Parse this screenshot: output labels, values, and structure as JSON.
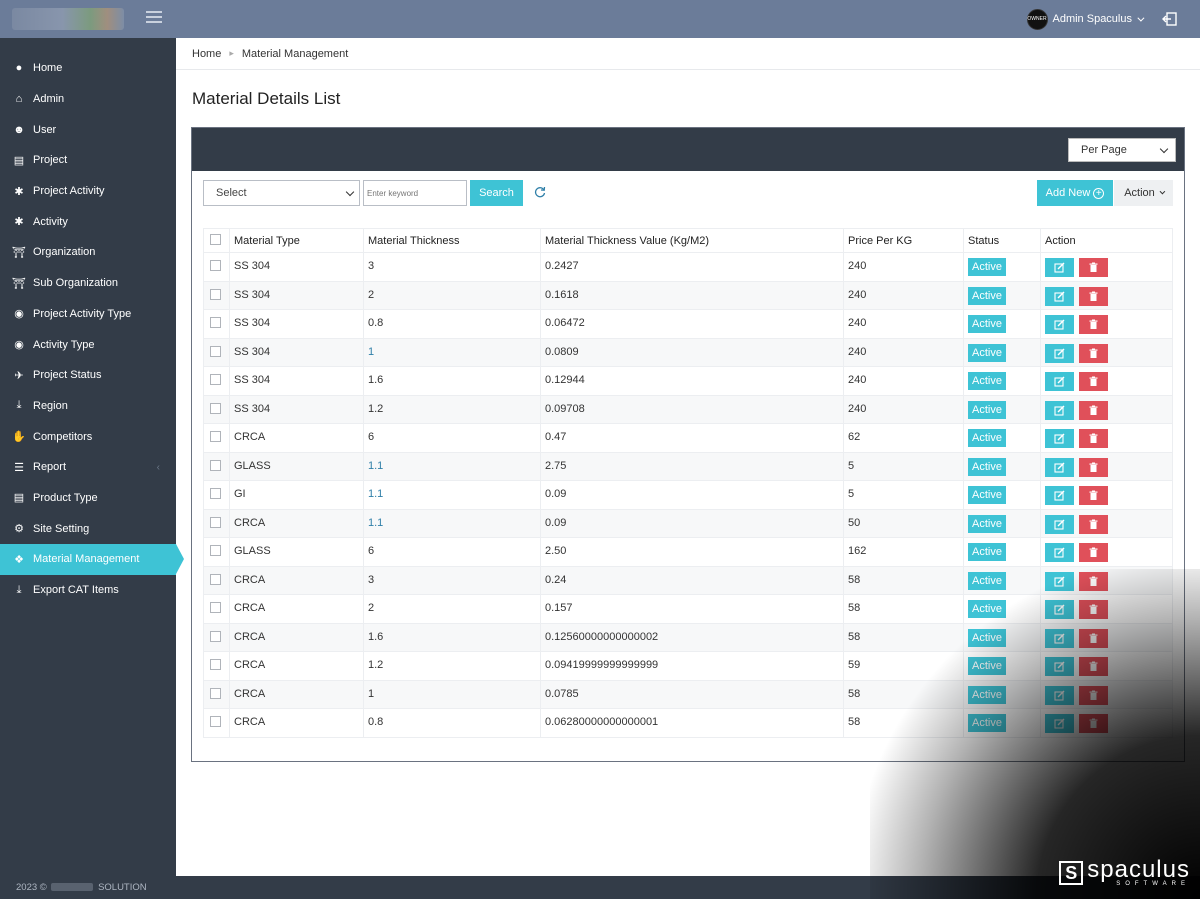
{
  "header": {
    "user_name": "Admin Spaculus",
    "avatar_text": "OWNER"
  },
  "sidebar": {
    "items": [
      {
        "label": "Home",
        "icon": "users-icon"
      },
      {
        "label": "Admin",
        "icon": "home-icon"
      },
      {
        "label": "User",
        "icon": "user-icon"
      },
      {
        "label": "Project",
        "icon": "laptop-icon"
      },
      {
        "label": "Project Activity",
        "icon": "asterisk-icon"
      },
      {
        "label": "Activity",
        "icon": "asterisk-icon"
      },
      {
        "label": "Organization",
        "icon": "bank-icon"
      },
      {
        "label": "Sub Organization",
        "icon": "bank-icon"
      },
      {
        "label": "Project Activity Type",
        "icon": "dot-circle-icon"
      },
      {
        "label": "Activity Type",
        "icon": "dot-circle-icon"
      },
      {
        "label": "Project Status",
        "icon": "plane-icon"
      },
      {
        "label": "Region",
        "icon": "download-icon"
      },
      {
        "label": "Competitors",
        "icon": "hand-icon"
      },
      {
        "label": "Report",
        "icon": "list-icon"
      },
      {
        "label": "Product Type",
        "icon": "list-alt-icon"
      },
      {
        "label": "Site Setting",
        "icon": "gear-icon"
      },
      {
        "label": "Material Management",
        "icon": "cubes-icon"
      },
      {
        "label": "Export CAT Items",
        "icon": "download-icon"
      }
    ],
    "active": "Material Management"
  },
  "footer": {
    "year": "2023 ©",
    "company": "SOLUTION"
  },
  "breadcrumb": {
    "home": "Home",
    "current": "Material Management"
  },
  "page": {
    "title": "Material Details List"
  },
  "controls": {
    "per_page": "Per Page",
    "select": "Select",
    "keyword_placeholder": "Enter keyword",
    "search": "Search",
    "add_new": "Add New",
    "action": "Action"
  },
  "table": {
    "columns": [
      "Material Type",
      "Material Thickness",
      "Material Thickness Value (Kg/M2)",
      "Price Per KG",
      "Status",
      "Action"
    ],
    "rows": [
      {
        "type": "SS 304",
        "thickness": "3",
        "value": "0.2427",
        "price": "240",
        "status": "Active"
      },
      {
        "type": "SS 304",
        "thickness": "2",
        "value": "0.1618",
        "price": "240",
        "status": "Active"
      },
      {
        "type": "SS 304",
        "thickness": "0.8",
        "value": "0.06472",
        "price": "240",
        "status": "Active"
      },
      {
        "type": "SS 304",
        "thickness": "1",
        "value": "0.0809",
        "price": "240",
        "status": "Active"
      },
      {
        "type": "SS 304",
        "thickness": "1.6",
        "value": "0.12944",
        "price": "240",
        "status": "Active"
      },
      {
        "type": "SS 304",
        "thickness": "1.2",
        "value": "0.09708",
        "price": "240",
        "status": "Active"
      },
      {
        "type": "CRCA",
        "thickness": "6",
        "value": "0.47",
        "price": "62",
        "status": "Active"
      },
      {
        "type": "GLASS",
        "thickness": "1.1",
        "value": "2.75",
        "price": "5",
        "status": "Active"
      },
      {
        "type": "GI",
        "thickness": "1.1",
        "value": "0.09",
        "price": "5",
        "status": "Active"
      },
      {
        "type": "CRCA",
        "thickness": "1.1",
        "value": "0.09",
        "price": "50",
        "status": "Active"
      },
      {
        "type": "GLASS",
        "thickness": "6",
        "value": "2.50",
        "price": "162",
        "status": "Active"
      },
      {
        "type": "CRCA",
        "thickness": "3",
        "value": "0.24",
        "price": "58",
        "status": "Active"
      },
      {
        "type": "CRCA",
        "thickness": "2",
        "value": "0.157",
        "price": "58",
        "status": "Active"
      },
      {
        "type": "CRCA",
        "thickness": "1.6",
        "value": "0.12560000000000002",
        "price": "58",
        "status": "Active"
      },
      {
        "type": "CRCA",
        "thickness": "1.2",
        "value": "0.09419999999999999",
        "price": "59",
        "status": "Active"
      },
      {
        "type": "CRCA",
        "thickness": "1",
        "value": "0.0785",
        "price": "58",
        "status": "Active"
      },
      {
        "type": "CRCA",
        "thickness": "0.8",
        "value": "0.06280000000000001",
        "price": "58",
        "status": "Active"
      }
    ]
  },
  "brand": {
    "name": "spaculus",
    "sub": "SOFTWARE"
  },
  "colors": {
    "accent": "#3ec3d5",
    "danger": "#e0505a",
    "sidebar": "#333c48",
    "topbar": "#6b7c99"
  }
}
